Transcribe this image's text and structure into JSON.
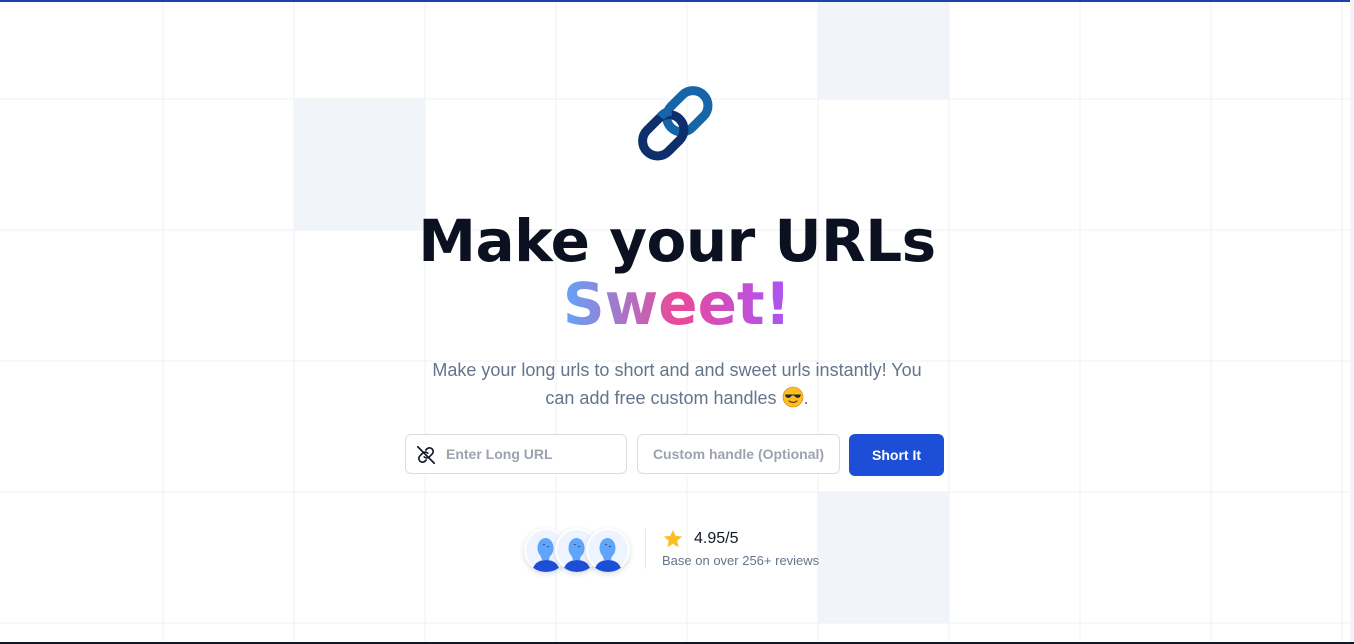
{
  "hero": {
    "logo_icon": "chain-link-icon",
    "headline_line1": "Make your URLs",
    "headline_line2": "Sweet!",
    "accent_gradient": [
      "#60a5fa",
      "#ec4899",
      "#a855f7"
    ],
    "subtitle_text": "Make your long urls to short and and sweet urls instantly! You can add free custom handles",
    "subtitle_emoji": "smiling-face-with-sunglasses-icon",
    "subtitle_end": "."
  },
  "form": {
    "url_icon": "link-icon",
    "url_placeholder": "Enter Long URL",
    "url_value": "",
    "handle_placeholder": "Custom handle (Optional)",
    "handle_value": "",
    "submit_label": "Short It",
    "submit_color": "#1d4ed8"
  },
  "social_proof": {
    "avatars": [
      "user-avatar-icon",
      "user-avatar-icon",
      "user-avatar-icon"
    ],
    "star_icon": "star-icon",
    "rating": "4.95/5",
    "reviews": "Base on over 256+ reviews"
  },
  "colors": {
    "top_border": "#1e40af",
    "headline": "#0b1120",
    "subtitle": "#64748b",
    "grid_line": "#eef1f5",
    "grid_cell": "#f1f5f9"
  }
}
